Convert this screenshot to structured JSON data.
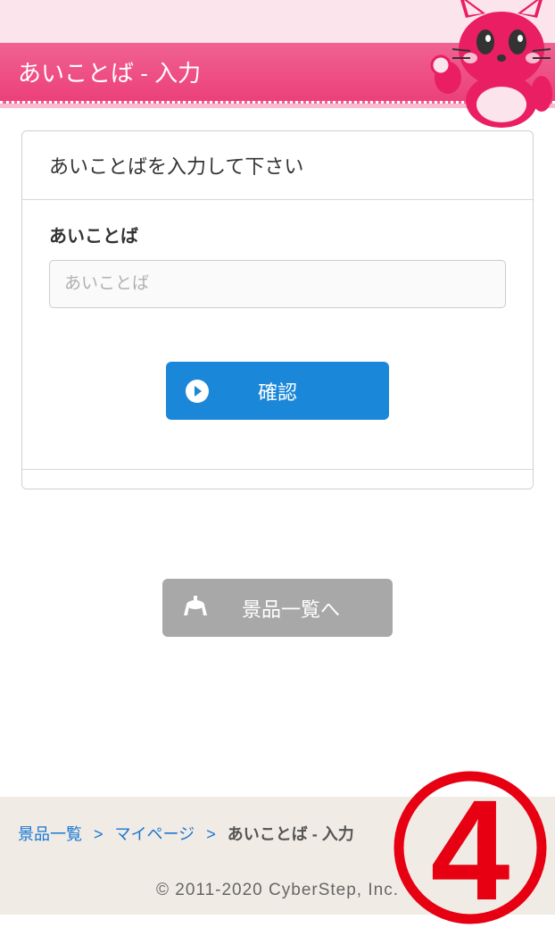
{
  "header": {
    "title": "あいことば - 入力"
  },
  "card": {
    "heading": "あいことばを入力して下さい",
    "field_label": "あいことば",
    "input_placeholder": "あいことば",
    "confirm_label": "確認"
  },
  "nav_button": {
    "label": "景品一覧へ"
  },
  "breadcrumb": {
    "items": [
      "景品一覧",
      "マイページ",
      "あいことば - 入力"
    ]
  },
  "footer": {
    "copyright": "© 2011-2020 CyberStep, Inc."
  },
  "badge": {
    "number": "4"
  }
}
